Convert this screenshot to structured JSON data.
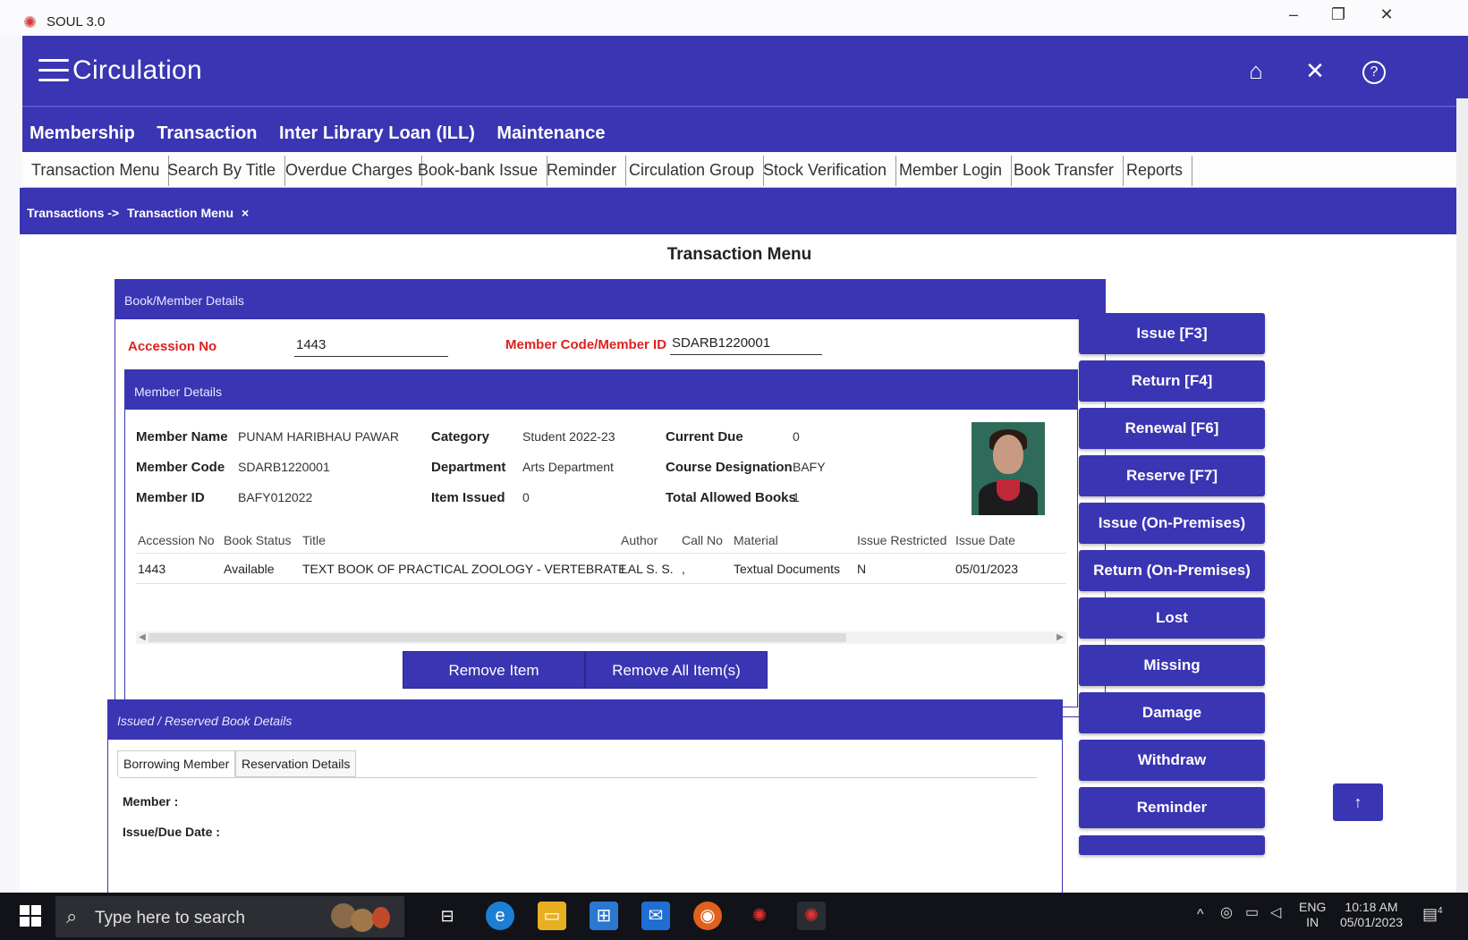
{
  "window": {
    "title": "SOUL 3.0",
    "minimize": "–",
    "restore": "❐",
    "close": "✕"
  },
  "header": {
    "title": "Circulation",
    "home_icon": "⌂",
    "close_icon": "✕",
    "help_icon": "?"
  },
  "main_menu": [
    "Membership",
    "Transaction",
    "Inter Library Loan (ILL)",
    "Maintenance"
  ],
  "sub_menu": [
    "Transaction Menu",
    "Search By Title",
    "Overdue Charges",
    "Book-bank Issue",
    "Reminder",
    "Circulation Group",
    "Stock Verification",
    "Member Login",
    "Book Transfer",
    "Reports"
  ],
  "breadcrumb": {
    "parent": "Transactions ->",
    "current": "Transaction Menu",
    "close": "×"
  },
  "page_title": "Transaction Menu",
  "book_member": {
    "header": "Book/Member Details",
    "accession_label": "Accession No",
    "accession_value": "1443",
    "member_code_label": "Member Code/Member ID",
    "member_code_value": "SDARB1220001"
  },
  "member_details": {
    "header": "Member Details",
    "name_label": "Member Name",
    "name_value": "PUNAM HARIBHAU PAWAR",
    "code_label": "Member Code",
    "code_value": "SDARB1220001",
    "id_label": "Member ID",
    "id_value": "BAFY012022",
    "category_label": "Category",
    "category_value": "Student 2022-23",
    "department_label": "Department",
    "department_value": "Arts Department",
    "issued_label": "Item Issued",
    "issued_value": "0",
    "due_label": "Current Due",
    "due_value": "0",
    "course_label": "Course Designation",
    "course_value": "BAFY",
    "allowed_label": "Total Allowed Books",
    "allowed_value": "1"
  },
  "items_table": {
    "columns": [
      "Accession No",
      "Book Status",
      "Title",
      "Author",
      "Call No",
      "Material",
      "Issue Restricted",
      "Issue Date"
    ],
    "rows": [
      [
        "1443",
        "Available",
        "TEXT BOOK OF PRACTICAL ZOOLOGY - VERTEBRATE",
        "LAL S. S.",
        ",",
        "Textual Documents",
        "N",
        "05/01/2023"
      ]
    ]
  },
  "buttons": {
    "remove_item": "Remove Item",
    "remove_all": "Remove All Item(s)"
  },
  "issued": {
    "header": "Issued / Reserved Book Details",
    "tab_borrowing": "Borrowing Member",
    "tab_reservation": "Reservation Details",
    "member_label": "Member :",
    "issue_due_label": "Issue/Due Date :"
  },
  "side_actions": [
    "Issue [F3]",
    "Return [F4]",
    "Renewal [F6]",
    "Reserve [F7]",
    "Issue (On-Premises)",
    "Return (On-Premises)",
    "Lost",
    "Missing",
    "Damage",
    "Withdraw",
    "Reminder"
  ],
  "scroll_top_icon": "↑",
  "taskbar": {
    "search_placeholder": "Type here to search",
    "lang_top": "ENG",
    "lang_bottom": "IN",
    "time": "10:18 AM",
    "date": "05/01/2023",
    "notification_count": "4"
  },
  "colors": {
    "primary": "#3a35b2",
    "required_label": "#e02020",
    "taskbar": "#111318"
  }
}
